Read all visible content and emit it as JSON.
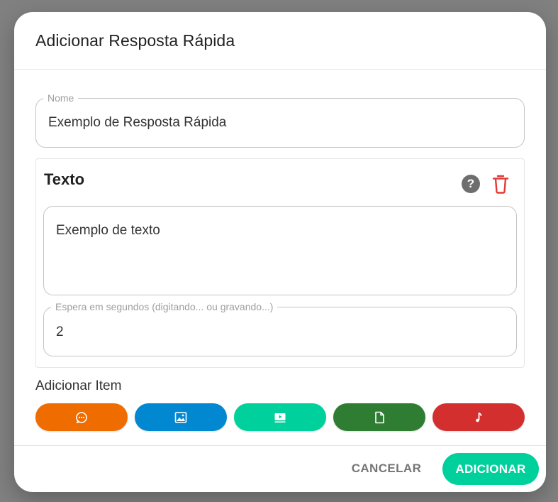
{
  "dialog": {
    "title": "Adicionar Resposta Rápida"
  },
  "name_field": {
    "label": "Nome",
    "value": "Exemplo de Resposta Rápida"
  },
  "text_card": {
    "title": "Texto",
    "help_symbol": "?",
    "message_value": "Exemplo de texto",
    "wait_label": "Espera em segundos (digitando... ou gravando...)",
    "wait_value": "2"
  },
  "add_item": {
    "label": "Adicionar Item",
    "buttons": [
      {
        "type": "text",
        "icon": "chat-bubble-icon",
        "color": "#ef6c00"
      },
      {
        "type": "image",
        "icon": "image-icon",
        "color": "#0288d1"
      },
      {
        "type": "video",
        "icon": "video-icon",
        "color": "#00d09c"
      },
      {
        "type": "document",
        "icon": "document-icon",
        "color": "#2e7d32"
      },
      {
        "type": "audio",
        "icon": "music-note-icon",
        "color": "#d32f2f"
      }
    ]
  },
  "footer": {
    "cancel_label": "CANCELAR",
    "add_label": "ADICIONAR"
  },
  "colors": {
    "accent": "#00d09c",
    "danger": "#e53935",
    "backdrop": "#808080"
  }
}
